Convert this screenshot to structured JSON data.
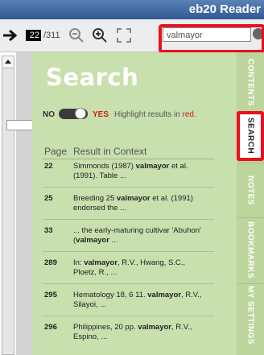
{
  "app": {
    "title": "eb20 Reader"
  },
  "toolbar": {
    "current_page": "22",
    "total_pages": "/311",
    "search_value": "valmayor",
    "icons": [
      "back-arrow-icon",
      "zoom-out-icon",
      "zoom-in-icon",
      "fullscreen-icon",
      "search-go-icon"
    ]
  },
  "panel": {
    "heading": "Search",
    "toggle": {
      "no": "NO",
      "yes": "YES",
      "hint_prefix": "Highlight results in ",
      "hint_red": "red",
      "hint_suffix": ".",
      "state": "yes"
    },
    "columns": {
      "page": "Page",
      "result": "Result in Context"
    },
    "results": [
      {
        "page": "22",
        "pre": "Simmonds (1987) ",
        "term": "valmayor",
        "post": " et al. (1991). Table ..."
      },
      {
        "page": "25",
        "pre": "Breeding 25 ",
        "term": "valmayor",
        "post": " et al. (1991) endorsed the ..."
      },
      {
        "page": "33",
        "pre": "... the early-maturing cultivar 'Abuhon' (",
        "term": "valmayor",
        "post": " ..."
      },
      {
        "page": "289",
        "pre": "In: ",
        "term": "valmayor",
        "post": ", R.V., Hwang, S.C., Ploetz, R., ..."
      },
      {
        "page": "295",
        "pre": "Hematology 18, 6 11. ",
        "term": "valmayor",
        "post": ", R.V., Silayoi, ..."
      },
      {
        "page": "296",
        "pre": "Philippines, 20 pp. ",
        "term": "valmayor",
        "post": ", R.V., Espino, ..."
      }
    ]
  },
  "side_tabs": {
    "contents": "CONTENTS",
    "search": "SEARCH",
    "notes": "NOTES",
    "bookmarks": "BOOKMARKS",
    "settings": "MY SETTINGS",
    "active": "search"
  },
  "colors": {
    "accent_red": "#e8111c",
    "panel_green": "#c8dfae",
    "title_blue": "#2f5a93"
  }
}
